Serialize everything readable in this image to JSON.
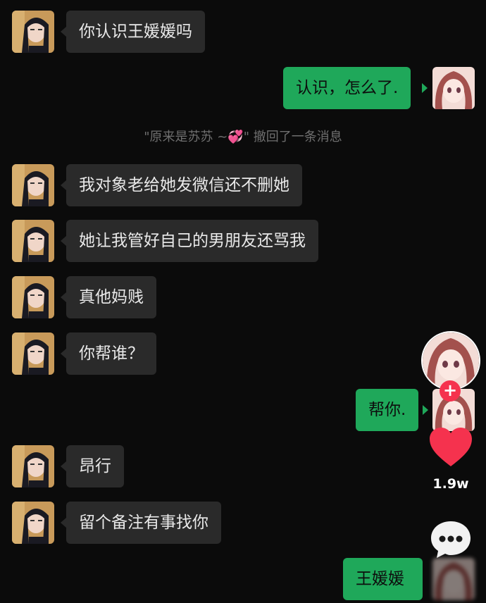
{
  "messages": [
    {
      "side": "in",
      "text": "你认识王媛媛吗"
    },
    {
      "side": "out",
      "text": "认识，怎么了."
    },
    {
      "side": "in",
      "text": "我对象老给她发微信还不删她"
    },
    {
      "side": "in",
      "text": "她让我管好自己的男朋友还骂我"
    },
    {
      "side": "in",
      "text": "真他妈贱"
    },
    {
      "side": "in",
      "text": "你帮谁？"
    },
    {
      "side": "out",
      "text": "帮你."
    },
    {
      "side": "in",
      "text": "昂行"
    },
    {
      "side": "in",
      "text": "留个备注有事找你"
    },
    {
      "side": "out",
      "text": "王媛媛"
    }
  ],
  "system_notice": {
    "name": "\"原来是苏苏 ~",
    "emoji": "💞",
    "suffix": "\" 撤回了一条消息"
  },
  "overlay": {
    "follow_symbol": "+",
    "like_count": "1.9w",
    "like_color": "#f5324e",
    "follow_color": "#f5324e",
    "icons": [
      "heart-icon",
      "comment-icon",
      "follow-plus-icon"
    ]
  },
  "colors": {
    "background": "#0b0b0b",
    "incoming_bubble": "#2a2a2a",
    "outgoing_bubble": "#1fa85a"
  }
}
